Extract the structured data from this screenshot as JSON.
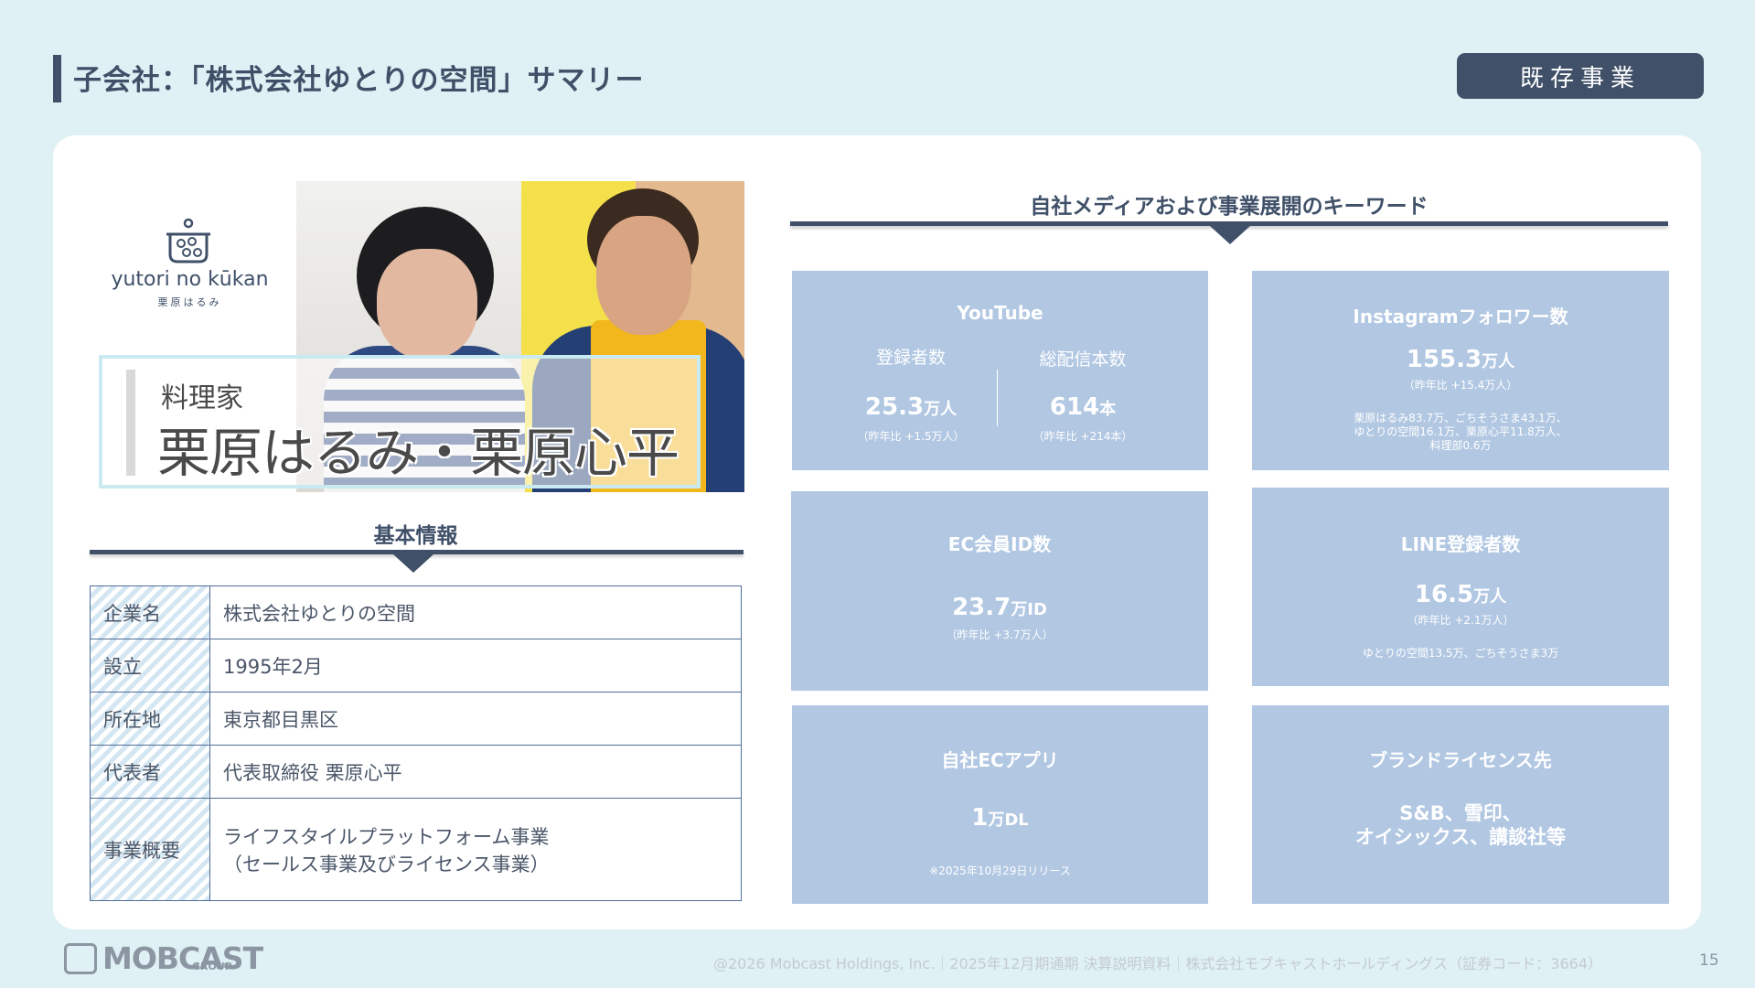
{
  "header": {
    "title": "子会社：「株式会社ゆとりの空間」サマリー",
    "tag": "既存事業"
  },
  "logo": {
    "text": "yutori no kūkan",
    "sub": "栗原はるみ"
  },
  "photo": {
    "role": "料理家",
    "names": "栗原はるみ・栗原心平"
  },
  "basic_info": {
    "title": "基本情報",
    "rows": [
      {
        "key": "企業名",
        "value": "株式会社ゆとりの空間"
      },
      {
        "key": "設立",
        "value": "1995年2月"
      },
      {
        "key": "所在地",
        "value": "東京都目黒区"
      },
      {
        "key": "代表者",
        "value": "代表取締役 栗原心平"
      },
      {
        "key": "事業概要",
        "value": "ライフスタイルプラットフォーム事業",
        "value2": "（セールス事業及びライセンス事業）"
      }
    ]
  },
  "keywords": {
    "title": "自社メディアおよび事業展開のキーワード",
    "youtube": {
      "title": "YouTube",
      "subs_label": "登録者数",
      "subs_value": "25.3",
      "subs_unit": "万人",
      "subs_note": "（昨年比 +1.5万人）",
      "videos_label": "総配信本数",
      "videos_value": "614",
      "videos_unit": "本",
      "videos_note": "（昨年比 +214本）"
    },
    "instagram": {
      "title": "Instagramフォロワー数",
      "value": "155.3",
      "unit": "万人",
      "note": "（昨年比 +15.4万人）",
      "detail1": "栗原はるみ83.7万、ごちそうさま43.1万、",
      "detail2": "ゆとりの空間16.1万、栗原心平11.8万人、",
      "detail3": "料理部0.6万"
    },
    "ec": {
      "title": "EC会員ID数",
      "value": "23.7",
      "unit": "万ID",
      "note": "（昨年比 +3.7万人）"
    },
    "line": {
      "title": "LINE登録者数",
      "value": "16.5",
      "unit": "万人",
      "note": "（昨年比 +2.1万人）",
      "detail": "ゆとりの空間13.5万、ごちそうさま3万"
    },
    "app": {
      "title": "自社ECアプリ",
      "value": "1",
      "unit": "万DL",
      "note": "※2025年10月29日リリース"
    },
    "brand": {
      "title": "ブランドライセンス先",
      "line1": "S&B、雪印、",
      "line2": "オイシックス、講談社等"
    }
  },
  "footer": {
    "brand": "MOBCAST",
    "brand_sub": "GROUP",
    "copyright": "@2026 Mobcast Holdings, Inc.｜2025年12月期通期 決算説明資料｜株式会社モブキャストホールディングス（証券コード：3664）",
    "page": "15"
  }
}
